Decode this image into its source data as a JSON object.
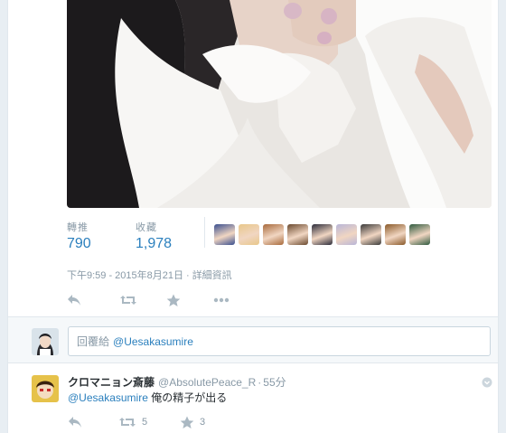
{
  "tweet": {
    "stats": {
      "retweets_label": "轉推",
      "retweets_count": "790",
      "favorites_label": "收藏",
      "favorites_count": "1,978"
    },
    "favoriter_avatars": [
      {
        "name": "favoriter-avatar-1",
        "color": "#3a4f8f"
      },
      {
        "name": "favoriter-avatar-2",
        "color": "#e8c78a"
      },
      {
        "name": "favoriter-avatar-3",
        "color": "#a86a3c"
      },
      {
        "name": "favoriter-avatar-4",
        "color": "#6b4a2f"
      },
      {
        "name": "favoriter-avatar-5",
        "color": "#2b2b3a"
      },
      {
        "name": "favoriter-avatar-6",
        "color": "#b9b6d8"
      },
      {
        "name": "favoriter-avatar-7",
        "color": "#3a3a3a"
      },
      {
        "name": "favoriter-avatar-8",
        "color": "#8a5a2a"
      },
      {
        "name": "favoriter-avatar-9",
        "color": "#2f5a3f"
      }
    ],
    "time": "下午9:59 - 2015年8月21日",
    "separator": "·",
    "details_link": "詳細資訊",
    "action_icons": [
      "reply-icon",
      "retweet-icon",
      "favorite-icon",
      "more-icon"
    ]
  },
  "reply_box": {
    "prefix": "回覆給",
    "mention": "@Uesakasumire"
  },
  "reply": {
    "display_name": "クロマニョン斎藤",
    "handle": "@AbsolutePeace_R",
    "dot": "·",
    "time": "55分",
    "mention": "@Uesakasumire",
    "text": " 俺の精子が出る",
    "retweet_count": "5",
    "favorite_count": "3",
    "action_icons": [
      "reply-icon",
      "retweet-icon",
      "favorite-icon"
    ]
  },
  "colors": {
    "link": "#2a7fbd",
    "muted": "#8899a6",
    "icon": "#aab8c2",
    "background": "#e8eef3"
  }
}
